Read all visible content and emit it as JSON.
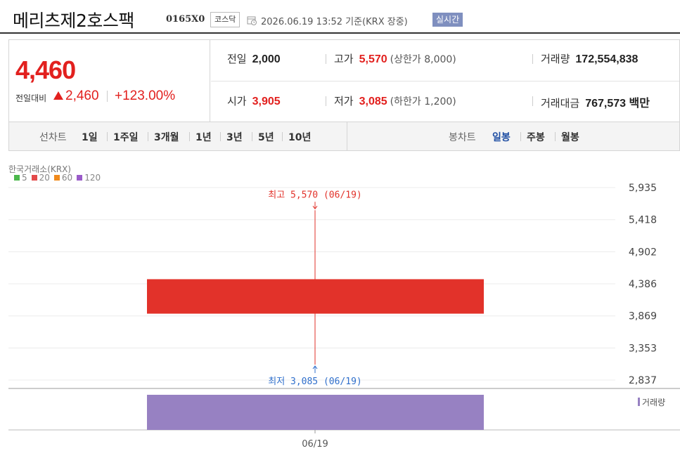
{
  "header": {
    "title": "메리츠제2호스팩",
    "code": "0165X0",
    "market": "코스닥",
    "datetime": "2026.06.19 13:52  기준(KRX 장중)",
    "realtime": "실시간"
  },
  "price": {
    "current": "4,460",
    "change_label": "전일대비",
    "change": "2,460",
    "change_pct": "+123.00%"
  },
  "stats": {
    "prev_close": {
      "label": "전일",
      "value": "2,000"
    },
    "high": {
      "label": "고가",
      "value": "5,570",
      "sub": "(상한가 8,000)"
    },
    "volume": {
      "label": "거래량",
      "value": "172,554,838"
    },
    "open": {
      "label": "시가",
      "value": "3,905"
    },
    "low": {
      "label": "저가",
      "value": "3,085",
      "sub": "(하한가 1,200)"
    },
    "amount": {
      "label": "거래대금",
      "value": "767,573 백만"
    }
  },
  "toolbar": {
    "line_chart_label": "선차트",
    "periods": [
      "1일",
      "1주일",
      "3개월",
      "1년",
      "3년",
      "5년",
      "10년"
    ],
    "candle_label": "봉차트",
    "candle_types": [
      "일봉",
      "주봉",
      "월봉"
    ],
    "active_candle": "일봉"
  },
  "chart": {
    "exchange": "한국거래소(KRX)",
    "legend": [
      {
        "name": "5",
        "color": "#4cb84c"
      },
      {
        "name": "20",
        "color": "#e34a4a"
      },
      {
        "name": "60",
        "color": "#f08a1c"
      },
      {
        "name": "120",
        "color": "#9a5bc9"
      }
    ],
    "high_label": "최고 5,570 (06/19)",
    "low_label": "최저 3,085 (06/19)",
    "volume_label": "거래량",
    "x_label": "06/19",
    "colors": {
      "up": "#e2322a",
      "volume": "#9781c2",
      "high": "#e2322a",
      "low": "#2f6fcc"
    }
  },
  "chart_data": {
    "type": "candlestick",
    "categories": [
      "06/19"
    ],
    "candles": [
      {
        "date": "06/19",
        "open": 3905,
        "high": 5570,
        "low": 3085,
        "close": 4460
      }
    ],
    "volume": [
      172554838
    ],
    "y_ticks": [
      5935,
      5418,
      4902,
      4386,
      3869,
      3353,
      2837
    ],
    "y_tick_labels": [
      "5,935",
      "5,418",
      "4,902",
      "4,386",
      "3,869",
      "3,353",
      "2,837"
    ],
    "ylim": [
      2837,
      5935
    ]
  }
}
